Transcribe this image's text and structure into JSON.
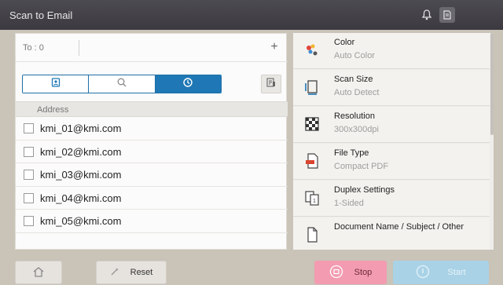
{
  "window": {
    "title": "Scan to Email"
  },
  "header_icons": [
    "bell-icon",
    "settings-icon"
  ],
  "to_field": {
    "label": "To : 0",
    "add_icon": "plus-icon"
  },
  "tabs": [
    {
      "name": "address-book",
      "icon": "address-book-icon",
      "active": false
    },
    {
      "name": "search",
      "icon": "search-icon",
      "active": false
    },
    {
      "name": "history",
      "icon": "clock-icon",
      "active": true
    }
  ],
  "address_list": {
    "header": "Address",
    "items": [
      "kmi_01@kmi.com",
      "kmi_02@kmi.com",
      "kmi_03@kmi.com",
      "kmi_04@kmi.com",
      "kmi_05@kmi.com"
    ]
  },
  "settings": [
    {
      "name": "Color",
      "value": "Auto Color",
      "icon": "color-icon"
    },
    {
      "name": "Scan Size",
      "value": "Auto Detect",
      "icon": "scan-size-icon"
    },
    {
      "name": "Resolution",
      "value": "300x300dpi",
      "icon": "resolution-icon"
    },
    {
      "name": "File Type",
      "value": "Compact PDF",
      "icon": "pdf-file-icon"
    },
    {
      "name": "Duplex Settings",
      "value": "1-Sided",
      "icon": "duplex-icon"
    },
    {
      "name": "Document Name / Subject / Other",
      "value": "",
      "icon": "document-icon"
    }
  ],
  "bottom": {
    "home_icon": "home-icon",
    "reset_label": "Reset",
    "stop_label": "Stop",
    "start_label": "Start"
  },
  "colors": {
    "accent": "#1f78b5",
    "stop": "#f39bb0",
    "start": "#a9d2e6",
    "titlebar": "#44424a"
  }
}
